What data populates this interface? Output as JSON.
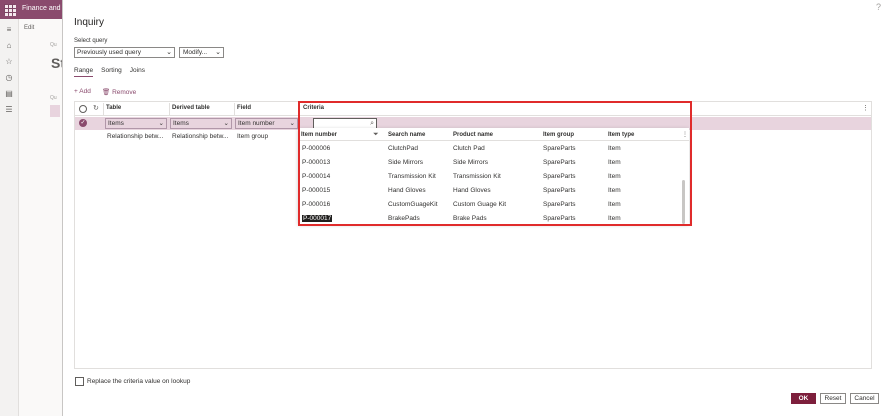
{
  "app": {
    "title": "Finance and Operations"
  },
  "background": {
    "edit_label": "Edit",
    "page_initial": "St",
    "query_label": "Qu"
  },
  "dialog": {
    "title": "Inquiry",
    "help": "?",
    "select_query_label": "Select query",
    "select_query_value": "Previously used query",
    "modify_label": "Modify..."
  },
  "tabs": [
    {
      "label": "Range",
      "active": true
    },
    {
      "label": "Sorting",
      "active": false
    },
    {
      "label": "Joins",
      "active": false
    }
  ],
  "actions": {
    "add": "Add",
    "remove": "Remove"
  },
  "grid": {
    "columns": [
      "Table",
      "Derived table",
      "Field",
      "Criteria"
    ],
    "rows": [
      {
        "table": "Items",
        "derived_table": "Items",
        "field": "Item number",
        "criteria": "",
        "selected": true
      },
      {
        "table": "Relationship betw...",
        "derived_table": "Relationship betw...",
        "field": "Item group",
        "criteria": "",
        "selected": false
      }
    ]
  },
  "lookup": {
    "columns": [
      "Item number",
      "Search name",
      "Product name",
      "Item group",
      "Item type"
    ],
    "rows": [
      {
        "item_number": "P-000006",
        "search_name": "ClutchPad",
        "product_name": "Clutch Pad",
        "item_group": "SpareParts",
        "item_type": "Item",
        "selected": false
      },
      {
        "item_number": "P-000013",
        "search_name": "Side Mirrors",
        "product_name": "Side Mirrors",
        "item_group": "SpareParts",
        "item_type": "Item",
        "selected": false
      },
      {
        "item_number": "P-000014",
        "search_name": "Transmission Kit",
        "product_name": "Transmission Kit",
        "item_group": "SpareParts",
        "item_type": "Item",
        "selected": false
      },
      {
        "item_number": "P-000015",
        "search_name": "Hand Gloves",
        "product_name": "Hand Gloves",
        "item_group": "SpareParts",
        "item_type": "Item",
        "selected": false
      },
      {
        "item_number": "P-000016",
        "search_name": "CustomGuageKit",
        "product_name": "Custom Guage Kit",
        "item_group": "SpareParts",
        "item_type": "Item",
        "selected": false
      },
      {
        "item_number": "P-000017",
        "search_name": "BrakePads",
        "product_name": "Brake Pads",
        "item_group": "SpareParts",
        "item_type": "Item",
        "selected": true
      }
    ]
  },
  "footer": {
    "checkbox_label": "Replace the criteria value on lookup",
    "ok": "OK",
    "reset": "Reset",
    "cancel": "Cancel"
  },
  "colors": {
    "accent": "#8a4a6d",
    "selected_row": "#e8d4de",
    "ok_button": "#7d1f3c",
    "highlight_frame": "#e02b2b"
  }
}
